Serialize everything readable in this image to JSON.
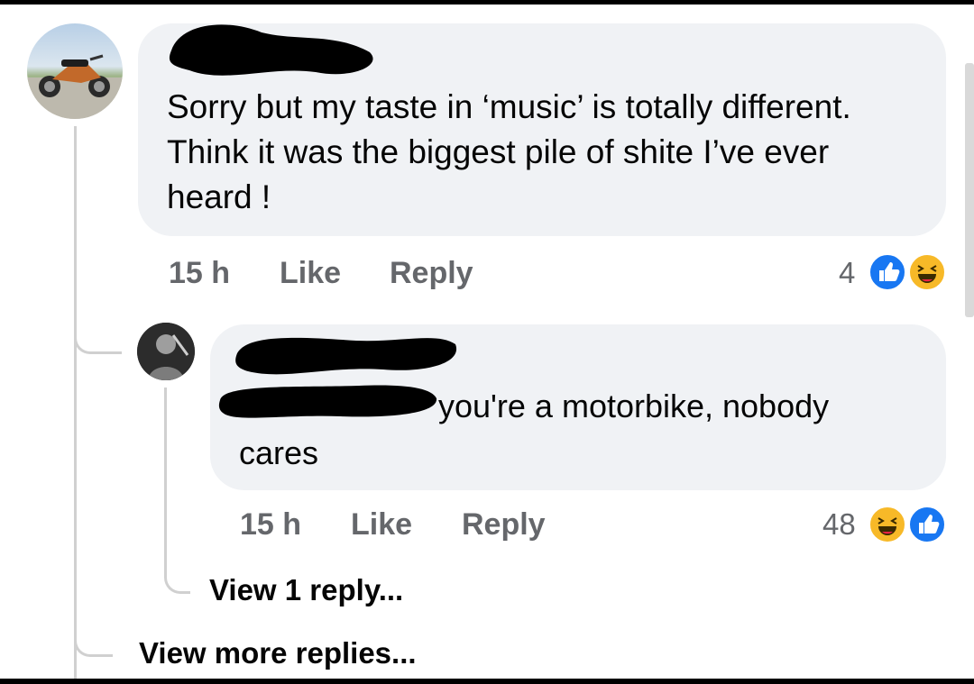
{
  "comment": {
    "text": "Sorry but my taste in ‘music’ is totally different. Think it was the biggest pile of shite I’ve ever heard !",
    "time": "15 h",
    "like_label": "Like",
    "reply_label": "Reply",
    "reaction_count": "4",
    "reactions": [
      "like-icon",
      "haha-icon"
    ]
  },
  "reply": {
    "text_line1": "you're a motorbike, nobody",
    "text_line2": "cares",
    "time": "15 h",
    "like_label": "Like",
    "reply_label": "Reply",
    "reaction_count": "48",
    "reactions": [
      "haha-icon",
      "like-icon"
    ]
  },
  "links": {
    "view_reply": "View 1 reply...",
    "view_more": "View more replies..."
  },
  "colors": {
    "bubble": "#f0f2f5",
    "meta_text": "#65676b",
    "like_blue": "#1877f2",
    "haha_yellow": "#f7b928"
  }
}
